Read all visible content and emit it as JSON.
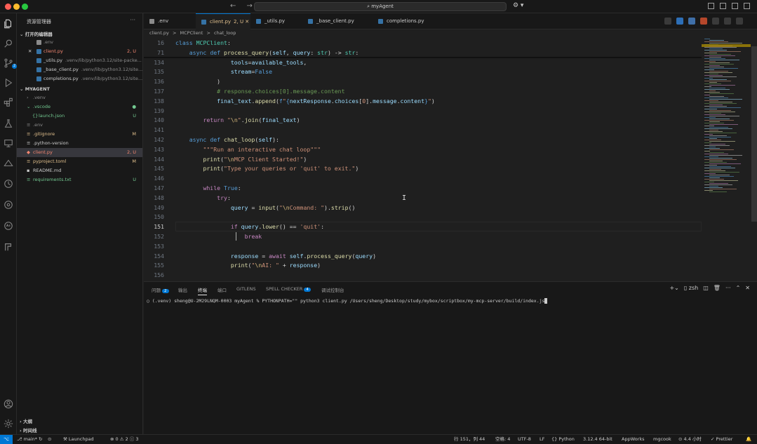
{
  "titlebar": {
    "search_text": "myAgent",
    "nav_arrows": "← →",
    "copilot": "⚙ ▾"
  },
  "sidebar": {
    "title": "资源管理器",
    "more": "···",
    "open_editors_section": "打开的编辑器",
    "open_editors": [
      {
        "name": ".env",
        "path": "",
        "status": "",
        "color": "c-ign"
      },
      {
        "name": "client.py",
        "path": "",
        "status": "2, U",
        "color": "c-err",
        "prefix": "✕"
      },
      {
        "name": "_utils.py",
        "path": ".venv/lib/python3.12/site-packe...",
        "status": "",
        "color": "c-def"
      },
      {
        "name": "_base_client.py",
        "path": ".venv/lib/python3.12/site...",
        "status": "",
        "color": "c-def"
      },
      {
        "name": "completions.py",
        "path": ".venv/lib/python3.12/site...",
        "status": "",
        "color": "c-def"
      }
    ],
    "project_section": "MYAGENT",
    "files": [
      {
        "name": ".venv",
        "status": "",
        "color": "c-ign",
        "indent": 14,
        "folder": true
      },
      {
        "name": ".vscode",
        "status": "●",
        "color": "c-new",
        "indent": 14,
        "folder": true,
        "open": true
      },
      {
        "name": "launch.json",
        "status": "U",
        "color": "c-new",
        "indent": 22
      },
      {
        "name": ".env",
        "status": "",
        "color": "c-ign",
        "indent": 14
      },
      {
        "name": ".gitignore",
        "status": "M",
        "color": "c-mod",
        "indent": 14
      },
      {
        "name": ".python-version",
        "status": "",
        "color": "c-def",
        "indent": 14
      },
      {
        "name": "client.py",
        "status": "2, U",
        "color": "c-err",
        "indent": 14,
        "selected": true
      },
      {
        "name": "pyproject.toml",
        "status": "M",
        "color": "c-mod",
        "indent": 14
      },
      {
        "name": "README.md",
        "status": "",
        "color": "c-def",
        "indent": 14
      },
      {
        "name": "requirements.txt",
        "status": "U",
        "color": "c-new",
        "indent": 14
      }
    ],
    "outline_section": "大纲",
    "timeline_section": "时间线"
  },
  "tabs": [
    {
      "label": ".env",
      "extra": "",
      "color": "#cccccc",
      "icon": "#8b8b8b"
    },
    {
      "label": "client.py",
      "extra": "2, U  ✕",
      "color": "#e2c08d",
      "icon": "#3572a5",
      "active": true
    },
    {
      "label": "_utils.py",
      "extra": "",
      "color": "#cccccc",
      "icon": "#3572a5"
    },
    {
      "label": "_base_client.py",
      "extra": "",
      "color": "#cccccc",
      "icon": "#3572a5"
    },
    {
      "label": "completions.py",
      "extra": "",
      "color": "#cccccc",
      "icon": "#3572a5"
    }
  ],
  "breadcrumb": [
    "client.py",
    ">",
    "MCPClient",
    ">",
    "chat_loop"
  ],
  "code_lines": [
    {
      "n": "16",
      "html": "<span class=\"k\">class</span> <span class=\"cls\">MCPClient</span><span class=\"p\">:</span>",
      "sticky": true
    },
    {
      "n": "71",
      "html": "    <span class=\"k\">async</span> <span class=\"k\">def</span> <span class=\"fn\">process_query</span><span class=\"p\">(</span><span class=\"v\">self</span><span class=\"p\">, </span><span class=\"v\">query</span><span class=\"p\">: </span><span class=\"cls\">str</span><span class=\"p\">) -> </span><span class=\"cls\">str</span><span class=\"p\">:</span>",
      "sticky": true
    },
    {
      "n": "134",
      "html": "                <span class=\"v\">tools</span><span class=\"p\">=</span><span class=\"v\">available_tools</span><span class=\"p\">,</span>"
    },
    {
      "n": "135",
      "html": "                <span class=\"v\">stream</span><span class=\"p\">=</span><span class=\"k\">False</span>"
    },
    {
      "n": "136",
      "html": "            <span class=\"p\">)</span>"
    },
    {
      "n": "137",
      "html": "            <span class=\"cm\"># response.choices[0].message.content</span>"
    },
    {
      "n": "138",
      "html": "            <span class=\"v\">final_text</span><span class=\"p\">.</span><span class=\"fn\">append</span><span class=\"p\">(</span><span class=\"k\">f</span><span class=\"s\">\"</span><span class=\"k\">{</span><span class=\"v\">nextResponse</span><span class=\"p\">.</span><span class=\"v\">choices</span><span class=\"p\">[</span><span class=\"s\">0</span><span class=\"p\">].</span><span class=\"v\">message</span><span class=\"p\">.</span><span class=\"v\">content</span><span class=\"k\">}</span><span class=\"s\">\"</span><span class=\"p\">)</span>"
    },
    {
      "n": "139",
      "html": ""
    },
    {
      "n": "140",
      "html": "        <span class=\"kc\">return</span> <span class=\"s\">\"</span><span class=\"es\">\\n</span><span class=\"s\">\"</span><span class=\"p\">.</span><span class=\"fn\">join</span><span class=\"p\">(</span><span class=\"v\">final_text</span><span class=\"p\">)</span>"
    },
    {
      "n": "141",
      "html": ""
    },
    {
      "n": "142",
      "html": "    <span class=\"k\">async</span> <span class=\"k\">def</span> <span class=\"fn\">chat_loop</span><span class=\"p\">(</span><span class=\"v\">self</span><span class=\"p\">):</span>"
    },
    {
      "n": "143",
      "html": "        <span class=\"s\">\"\"\"Run an interactive chat loop\"\"\"</span>"
    },
    {
      "n": "144",
      "html": "        <span class=\"fn\">print</span><span class=\"p\">(</span><span class=\"s\">\"</span><span class=\"es\">\\n</span><span class=\"s\">MCP Client Started!\"</span><span class=\"p\">)</span>"
    },
    {
      "n": "145",
      "html": "        <span class=\"fn\">print</span><span class=\"p\">(</span><span class=\"s\">\"Type your queries or 'quit' to exit.\"</span><span class=\"p\">)</span>"
    },
    {
      "n": "146",
      "html": ""
    },
    {
      "n": "147",
      "html": "        <span class=\"kc\">while</span> <span class=\"k\">True</span><span class=\"p\">:</span>"
    },
    {
      "n": "148",
      "html": "            <span class=\"kc\">try</span><span class=\"p\">:</span>"
    },
    {
      "n": "149",
      "html": "                <span class=\"v\">query</span> <span class=\"p\">=</span> <span class=\"fn\">input</span><span class=\"p\">(</span><span class=\"s\">\"</span><span class=\"es\">\\n</span><span class=\"s\">Command: \"</span><span class=\"p\">).</span><span class=\"fn\">strip</span><span class=\"p\">()</span>"
    },
    {
      "n": "150",
      "html": ""
    },
    {
      "n": "151",
      "html": "                <span class=\"kc\">if</span> <span class=\"v\">query</span><span class=\"p\">.</span><span class=\"fn\">lower</span><span class=\"p\">() == </span><span class=\"s\">'quit'</span><span class=\"p\">:</span>",
      "current": true
    },
    {
      "n": "152",
      "html": "                    <span class=\"kc\">break</span>"
    },
    {
      "n": "153",
      "html": ""
    },
    {
      "n": "154",
      "html": "                <span class=\"v\">response</span> <span class=\"p\">=</span> <span class=\"kc\">await</span> <span class=\"v\">self</span><span class=\"p\">.</span><span class=\"fn\">process_query</span><span class=\"p\">(</span><span class=\"v\">query</span><span class=\"p\">)</span>"
    },
    {
      "n": "155",
      "html": "                <span class=\"fn\">print</span><span class=\"p\">(</span><span class=\"s\">\"</span><span class=\"es\">\\n</span><span class=\"s\">AI: \"</span> <span class=\"p\">+</span> <span class=\"v\">response</span><span class=\"p\">)</span>"
    },
    {
      "n": "156",
      "html": ""
    }
  ],
  "panel": {
    "tabs": [
      {
        "label": "问题",
        "badge": "2"
      },
      {
        "label": "输出"
      },
      {
        "label": "终端",
        "active": true
      },
      {
        "label": "端口"
      },
      {
        "label": "GITLENS"
      },
      {
        "label": "SPELL CHECKER",
        "badge": "4"
      },
      {
        "label": "调试控制台"
      }
    ],
    "shell": "zsh",
    "terminal_text": "○ (.venv) sheng@U-2M29LNQM-0003 myAgent % PYTHONPATH=\"\" python3 client.py /Users/sheng/Desktop/study/mybox/scriptbox/my-mcp-server/build/index.js"
  },
  "statusbar": {
    "branch": "main*",
    "launchpad": "Launchpad",
    "problems": "⊗ 0 ⚠ 2 ⓘ 3",
    "position": "行 151，列 44",
    "spaces": "空格: 4",
    "encoding": "UTF-8",
    "eol": "LF",
    "language": "Python",
    "interpreter": "3.12.4 64-bit",
    "appworks": "AppWorks",
    "user": "mgcook",
    "time": "4.4 小时",
    "prettier": "✓ Prettier"
  }
}
